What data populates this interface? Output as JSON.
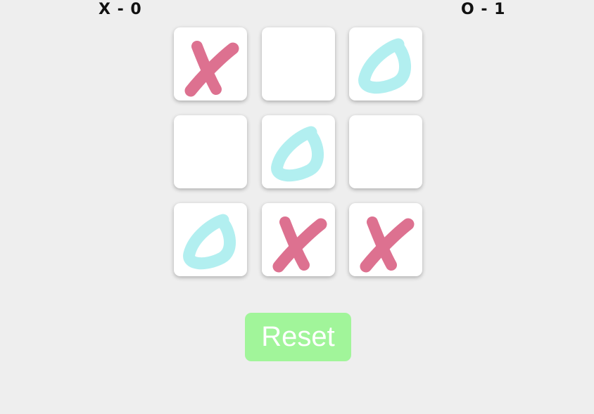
{
  "score": {
    "x_text": "X - 0",
    "o_text": "O - 1"
  },
  "board": {
    "cells": [
      "X",
      "",
      "O",
      "",
      "O",
      "",
      "O",
      "X",
      "X"
    ]
  },
  "colors": {
    "x_mark": "#dd7190",
    "o_mark": "#b2eff0",
    "reset_bg": "#a1f59a",
    "background": "#eeeeee"
  },
  "reset_label": "Reset"
}
